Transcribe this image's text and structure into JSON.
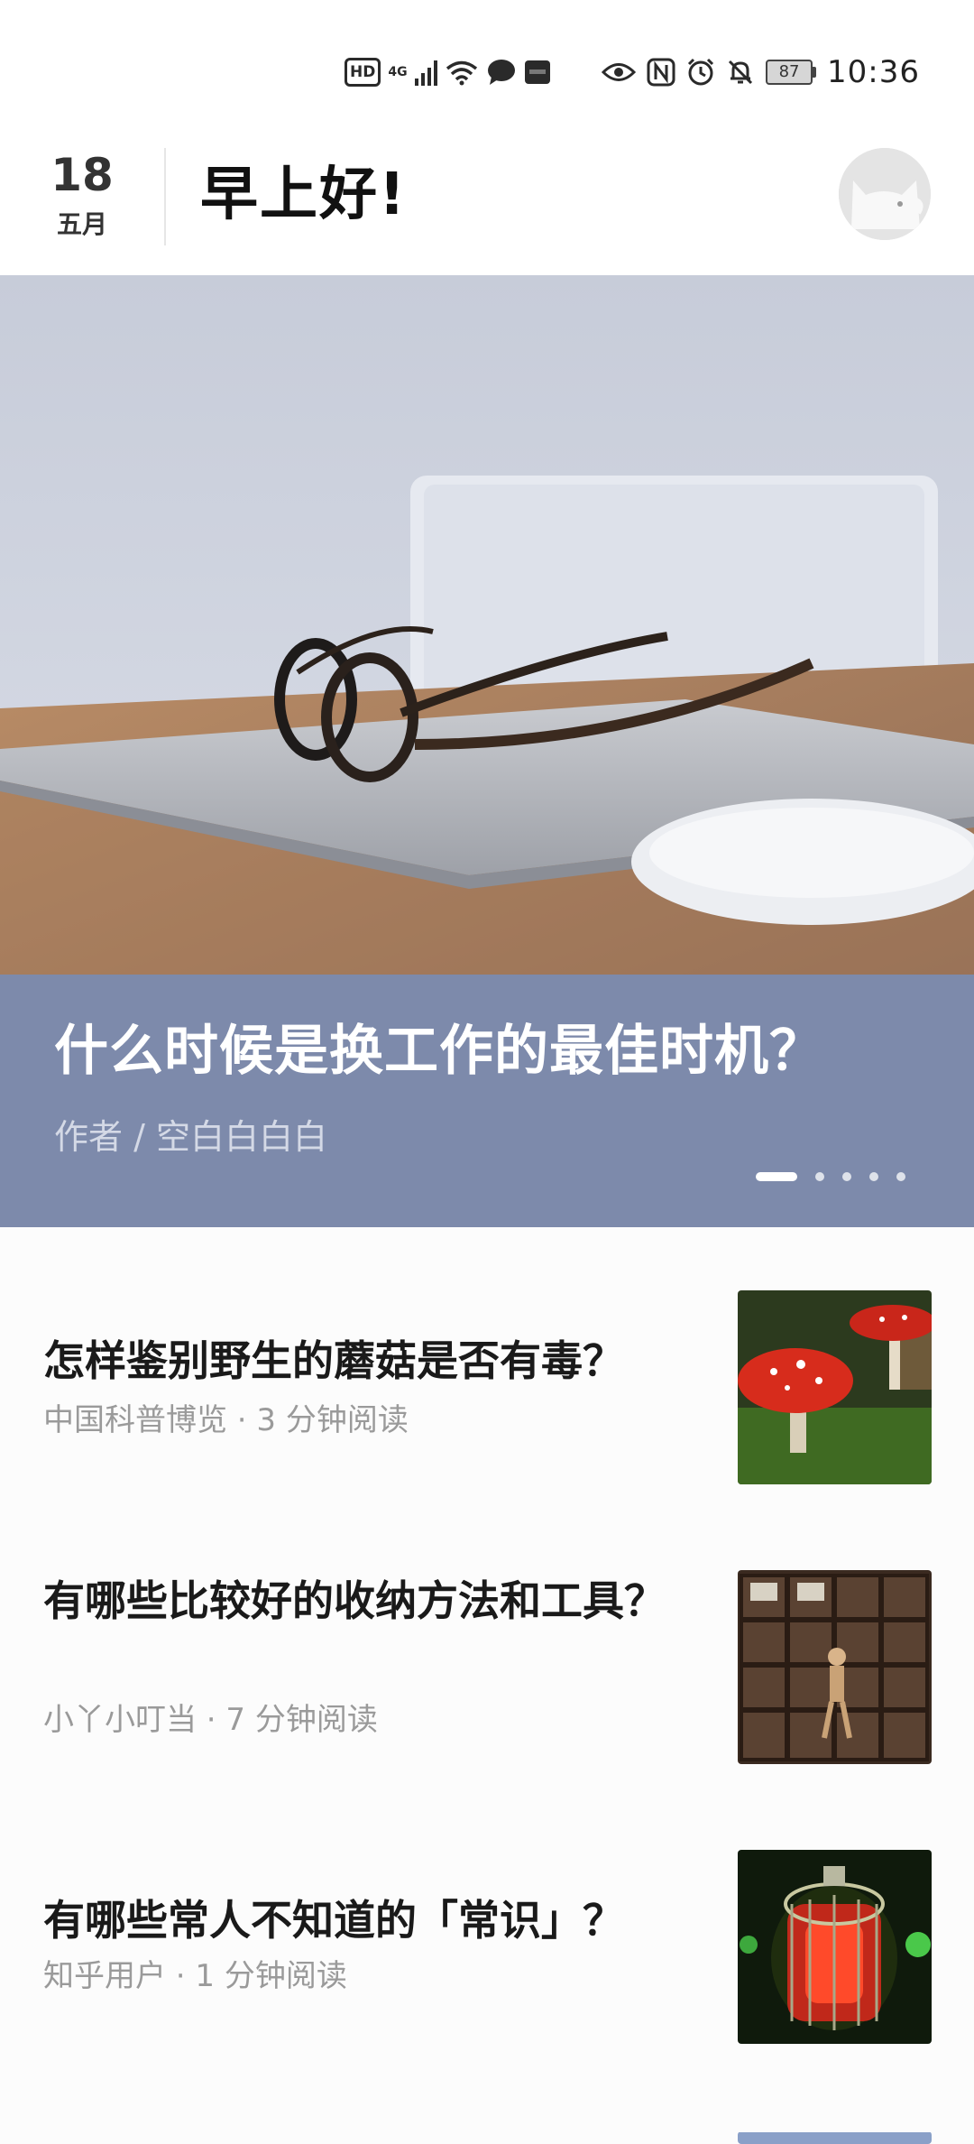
{
  "status_bar": {
    "hd_label": "HD",
    "network_label": "4G",
    "battery_level": "87",
    "time": "10:36",
    "icons": [
      "hd-icon",
      "signal-icon",
      "wifi-icon",
      "message-icon",
      "notification-icon",
      "eye-icon",
      "nfc-icon",
      "alarm-icon",
      "mute-icon",
      "battery-icon"
    ]
  },
  "header": {
    "date_day": "18",
    "date_month": "五月",
    "greeting": "早上好!"
  },
  "hero": {
    "title": "什么时候是换工作的最佳时机？",
    "author": "作者 / 空白白白白",
    "carousel_total": 5,
    "carousel_active_index": 0
  },
  "articles": [
    {
      "title": "怎样鉴别野生的蘑菇是否有毒？",
      "meta": "中国科普博览 · 3 分钟阅读"
    },
    {
      "title": "有哪些比较好的收纳方法和工具？",
      "meta": "小丫小叮当 · 7 分钟阅读"
    },
    {
      "title": "有哪些常人不知道的「常识」？",
      "meta": "知乎用户 · 1 分钟阅读"
    }
  ]
}
